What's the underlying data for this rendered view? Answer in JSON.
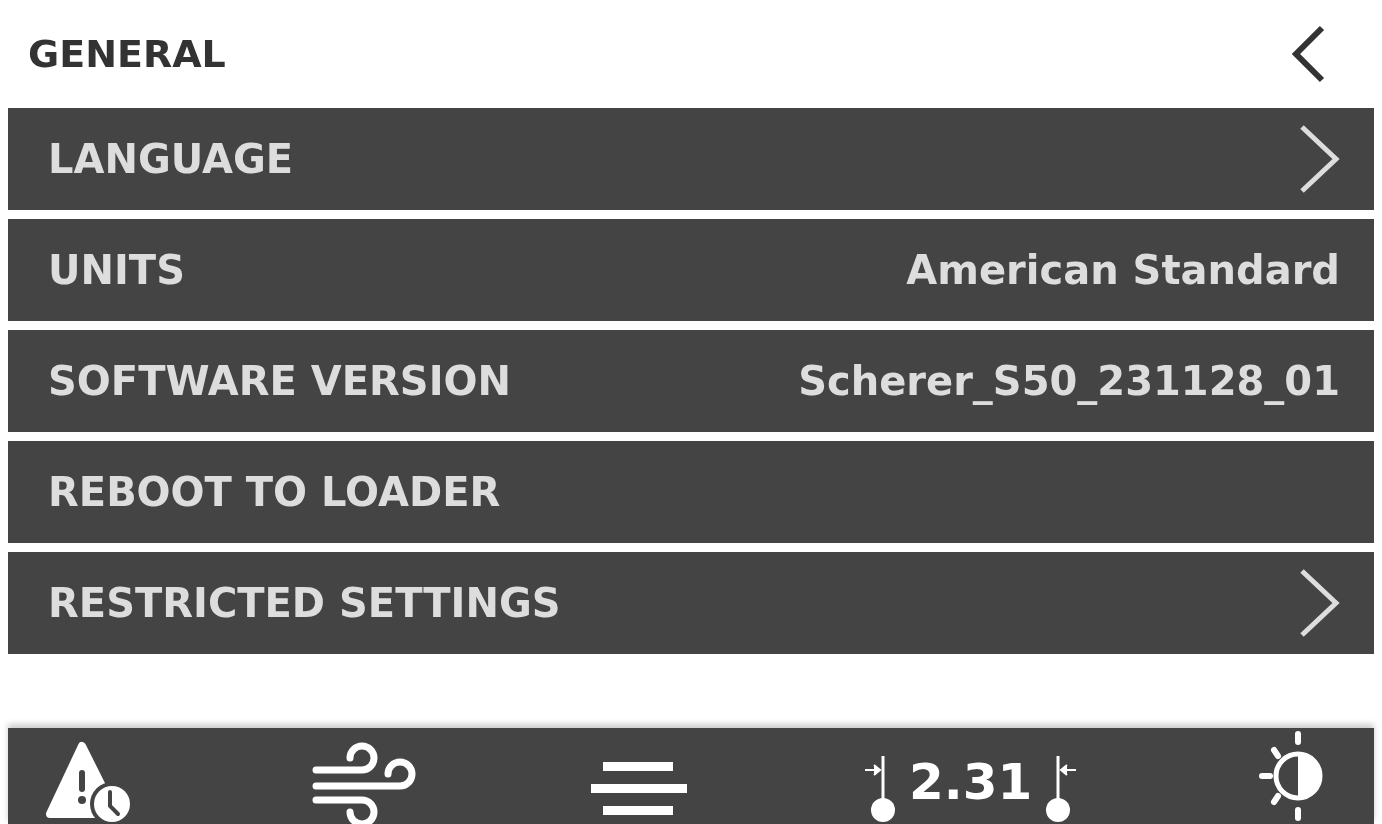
{
  "header": {
    "title": "GENERAL"
  },
  "rows": [
    {
      "kind": "chevron",
      "label": "LANGUAGE"
    },
    {
      "kind": "value",
      "label": "UNITS",
      "value": "American Standard"
    },
    {
      "kind": "value",
      "label": "SOFTWARE VERSION",
      "value": "Scherer_S50_231128_01"
    },
    {
      "kind": "plain",
      "label": "REBOOT TO LOADER"
    },
    {
      "kind": "chevron",
      "label": "RESTRICTED SETTINGS"
    }
  ],
  "bottom_bar": {
    "gap_reading": "2.31"
  }
}
